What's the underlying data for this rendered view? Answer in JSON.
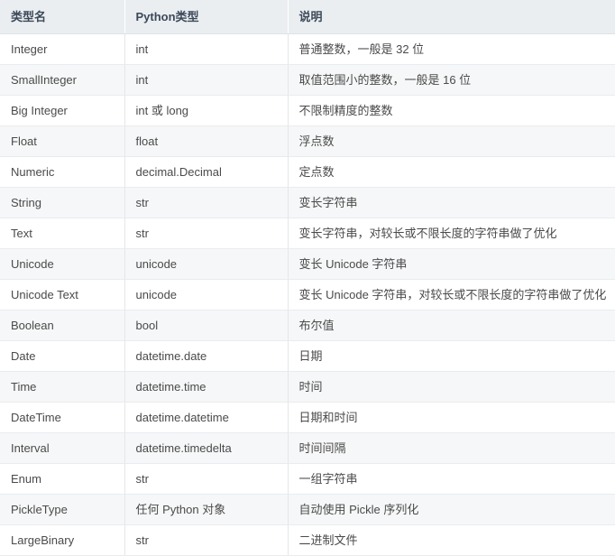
{
  "table": {
    "columns": [
      {
        "key": "type_name",
        "label": "类型名"
      },
      {
        "key": "python_type",
        "label": "Python类型"
      },
      {
        "key": "description",
        "label": "说明"
      }
    ],
    "rows": [
      {
        "type_name": "Integer",
        "python_type": "int",
        "description": "普通整数，一般是 32 位"
      },
      {
        "type_name": "SmallInteger",
        "python_type": "int",
        "description": "取值范围小的整数，一般是 16 位"
      },
      {
        "type_name": "Big Integer",
        "python_type": "int 或 long",
        "description": "不限制精度的整数"
      },
      {
        "type_name": "Float",
        "python_type": "float",
        "description": "浮点数"
      },
      {
        "type_name": "Numeric",
        "python_type": "decimal.Decimal",
        "description": "定点数"
      },
      {
        "type_name": "String",
        "python_type": "str",
        "description": "变长字符串"
      },
      {
        "type_name": "Text",
        "python_type": "str",
        "description": "变长字符串，对较长或不限长度的字符串做了优化"
      },
      {
        "type_name": "Unicode",
        "python_type": "unicode",
        "description": "变长 Unicode 字符串"
      },
      {
        "type_name": "Unicode Text",
        "python_type": "unicode",
        "description": "变长 Unicode 字符串，对较长或不限长度的字符串做了优化"
      },
      {
        "type_name": "Boolean",
        "python_type": "bool",
        "description": "布尔值"
      },
      {
        "type_name": "Date",
        "python_type": "datetime.date",
        "description": "日期"
      },
      {
        "type_name": "Time",
        "python_type": "datetime.time",
        "description": "时间"
      },
      {
        "type_name": "DateTime",
        "python_type": "datetime.datetime",
        "description": "日期和时间"
      },
      {
        "type_name": "Interval",
        "python_type": "datetime.timedelta",
        "description": "时间间隔"
      },
      {
        "type_name": "Enum",
        "python_type": "str",
        "description": "一组字符串"
      },
      {
        "type_name": "PickleType",
        "python_type": "任何 Python 对象",
        "description": "自动使用 Pickle 序列化"
      },
      {
        "type_name": "LargeBinary",
        "python_type": "str",
        "description": "二进制文件"
      }
    ]
  },
  "colors": {
    "header_bg": "#eaeef1",
    "header_text": "#3c4858",
    "row_stripe_bg": "#f6f7f8",
    "row_bg": "#ffffff",
    "border": "#e3e6e8",
    "body_text": "#4a4a4a"
  }
}
